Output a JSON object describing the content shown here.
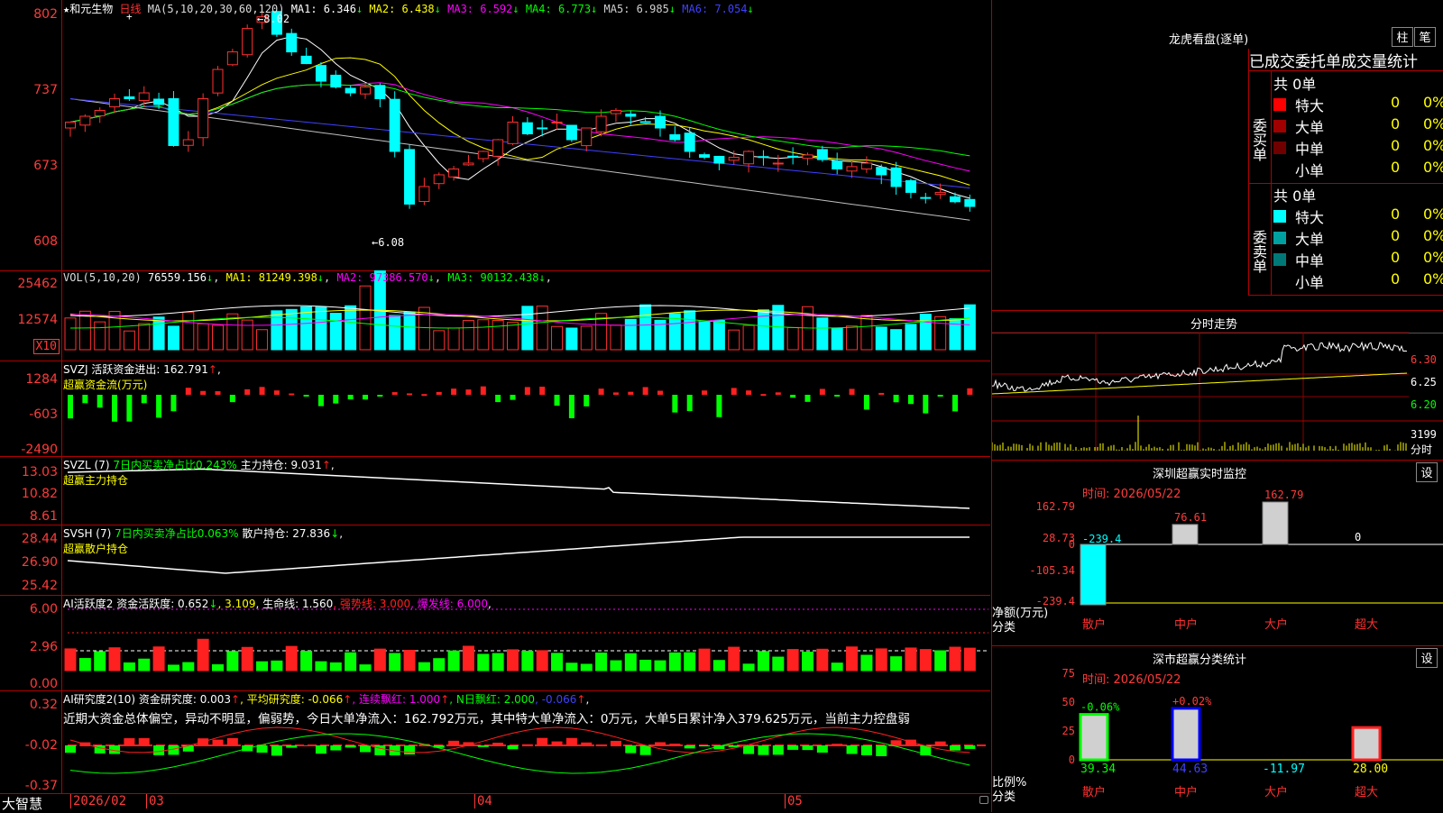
{
  "stock": {
    "star": "★",
    "name": "和元生物",
    "period": "日线"
  },
  "main_panel": {
    "ma_prefix": "MA(5,10,20,30,60,120)",
    "ma": [
      {
        "label": "MA1: 6.346",
        "arrow": "↓",
        "color": "#ffffff"
      },
      {
        "label": "MA2: 6.438",
        "arrow": "↓",
        "color": "#ffff00"
      },
      {
        "label": "MA3: 6.592",
        "arrow": "↓",
        "color": "#ff00ff"
      },
      {
        "label": "MA4: 6.773",
        "arrow": "↓",
        "color": "#00ff00"
      },
      {
        "label": "MA5: 6.985",
        "arrow": "↓",
        "color": "#d0d0d0"
      },
      {
        "label": "MA6: 7.054",
        "arrow": "↓",
        "color": "#4040ff"
      }
    ],
    "y_ticks": [
      "802",
      "737",
      "673",
      "608"
    ],
    "y_ticks_v": [
      8.02,
      7.37,
      6.73,
      6.08
    ],
    "high_label": "8.02",
    "low_label": "6.08"
  },
  "volume_panel": {
    "header": [
      {
        "label": "VOL(5,10,20)",
        "color": "#dddddd"
      },
      {
        "label": "76559.156",
        "arrow": "↓",
        "color": "#ffffff"
      },
      {
        "label": "MA1: 81249.398",
        "arrow": "↓",
        "color": "#ffff00"
      },
      {
        "label": "MA2: 97386.570",
        "arrow": "↓",
        "color": "#ff00ff"
      },
      {
        "label": "MA3: 90132.438",
        "arrow": "↓",
        "color": "#00ff00"
      }
    ],
    "y_ticks": [
      "25462",
      "12574"
    ],
    "unit": "X10"
  },
  "svzj_panel": {
    "header1": "SVZJ  活跃资金进出: 162.791",
    "arrow": "↑",
    "header1_tail": ",",
    "header2": "超赢资金流(万元)",
    "y_ticks": [
      "1284",
      "-603",
      "-2490"
    ]
  },
  "svzl_panel": {
    "header_a": "SVZL (7)",
    "header_b": "7日内买卖净占比0.243%",
    "header_c": "主力持仓: 9.031",
    "arrow": "↑",
    "tail": ",",
    "header2": "超赢主力持仓",
    "y_ticks": [
      "13.03",
      "10.82",
      "8.61"
    ]
  },
  "svsh_panel": {
    "header_a": "SVSH (7)",
    "header_b": "7日内买卖净占比0.063%",
    "header_c": "散户持仓: 27.836",
    "arrow": "↓",
    "tail": ",",
    "header2": "超赢散户持仓",
    "y_ticks": [
      "28.44",
      "26.90",
      "25.42"
    ]
  },
  "ai_active_panel": {
    "items": [
      {
        "label": "AI活跃度2 资金活跃度: 0.652",
        "color": "#ffffff"
      },
      {
        "label": "↓",
        "color": "#00ff00"
      },
      {
        "label": ", 3.109",
        "color": "#ffff00"
      },
      {
        "label": ", 生命线: 1.560",
        "color": "#ffffff"
      },
      {
        "label": ", 强势线: 3.000",
        "color": "#ff2020"
      },
      {
        "label": ", 爆发线: 6.000",
        "color": "#ff00ff"
      },
      {
        "label": ",",
        "color": "#ffffff"
      }
    ],
    "y_ticks": [
      "6.00",
      "2.96",
      "0.00"
    ]
  },
  "ai_research_panel": {
    "items": [
      {
        "label": "AI研究度2(10) 资金研究度: 0.003",
        "color": "#ffffff"
      },
      {
        "label": "↑",
        "color": "#ff2020"
      },
      {
        "label": ", 平均研究度: -0.066",
        "color": "#ffff00"
      },
      {
        "label": "↑",
        "color": "#ff2020"
      },
      {
        "label": ", 连续飘红: 1.000",
        "color": "#ff00ff"
      },
      {
        "label": "↑",
        "color": "#ff2020"
      },
      {
        "label": ", N日飘红: 2.000",
        "color": "#00ff00"
      },
      {
        "label": ", -0.066",
        "color": "#4040ff"
      },
      {
        "label": "↑",
        "color": "#ff2020"
      },
      {
        "label": ",",
        "color": "#ffffff"
      }
    ],
    "comment": "近期大资金总体偏空，异动不明显，偏弱势，今日大单净流入：162.792万元，其中特大单净流入：0万元，大单5日累计净入379.625万元，当前主力控盘弱",
    "y_ticks": [
      "0.32",
      "-0.02",
      "-0.37"
    ]
  },
  "bottom_bar": {
    "app": "大智慧",
    "dates": [
      {
        "label": "2026/02",
        "x": 78
      },
      {
        "label": "03",
        "x": 162
      },
      {
        "label": "04",
        "x": 526
      },
      {
        "label": "05",
        "x": 870
      }
    ]
  },
  "right": {
    "dragon_tiger": {
      "title": "龙虎看盘(逐单)",
      "btn1": "柱",
      "btn2": "笔",
      "subtitle": "已成交委托单成交量统计",
      "buy_label": "委买单",
      "sell_label": "委卖单",
      "buy_total": "共 0单",
      "sell_total": "共 0单",
      "buy_rows": [
        {
          "name": "特大",
          "count": "0",
          "pct": "0%",
          "color": "#ff0000"
        },
        {
          "name": "大单",
          "count": "0",
          "pct": "0%",
          "color": "#a00000"
        },
        {
          "name": "中单",
          "count": "0",
          "pct": "0%",
          "color": "#700000"
        },
        {
          "name": "小单",
          "count": "0",
          "pct": "0%",
          "color": "#000000"
        }
      ],
      "sell_rows": [
        {
          "name": "特大",
          "count": "0",
          "pct": "0%",
          "color": "#00ffff"
        },
        {
          "name": "大单",
          "count": "0",
          "pct": "0%",
          "color": "#00a0a0"
        },
        {
          "name": "中单",
          "count": "0",
          "pct": "0%",
          "color": "#007878"
        },
        {
          "name": "小单",
          "count": "0",
          "pct": "0%",
          "color": "#000000"
        }
      ]
    },
    "intraday": {
      "title": "分时走势",
      "prices": [
        "6.30",
        "6.25",
        "6.20"
      ],
      "vol": "3199",
      "vol_unit": "分时"
    },
    "sz_monitor": {
      "title": "深圳超赢实时监控",
      "btn": "设",
      "time": "时间: 2026/05/22",
      "y_ticks": [
        "162.79",
        "28.73",
        "0",
        "-105.34",
        "-239.4"
      ],
      "axis_label1": "净额(万元)",
      "axis_label2": "分类",
      "categories": [
        "散户",
        "中户",
        "大户",
        "超大"
      ],
      "values": [
        -239.4,
        76.61,
        162.79,
        0
      ],
      "value_labels": [
        "-239.4",
        "76.61",
        "162.79",
        "0"
      ]
    },
    "sz_classify": {
      "title": "深市超赢分类统计",
      "btn": "设",
      "time": "时间: 2026/05/22",
      "y_ticks": [
        "75",
        "50",
        "25",
        "0"
      ],
      "axis_label1": "比例%",
      "axis_label2": "分类",
      "categories": [
        "散户",
        "中户",
        "大户",
        "超大"
      ],
      "top_labels": [
        "-0.06%",
        "+0.02%",
        "",
        ""
      ],
      "bottom_labels": [
        "39.34",
        "44.63",
        "-11.97",
        "28.00"
      ],
      "values": [
        39.34,
        44.63,
        -11.97,
        28.0
      ]
    }
  }
}
